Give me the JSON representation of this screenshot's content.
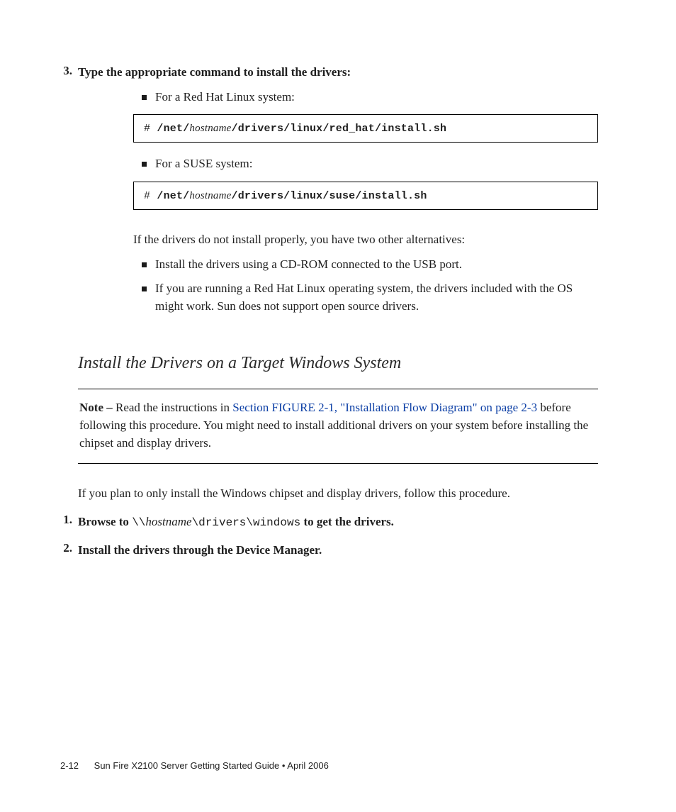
{
  "step3": {
    "num": "3.",
    "text": "Type the appropriate command to install the drivers:",
    "bullet_redhat": "For a Red Hat Linux system:",
    "bullet_suse": "For a SUSE system:"
  },
  "code_redhat": {
    "hash": "#",
    "seg1": "/net/",
    "seg2": "hostname",
    "seg3": "/drivers/linux/red_hat/install.sh"
  },
  "code_suse": {
    "hash": "#",
    "seg1": "/net/",
    "seg2": "hostname",
    "seg3": "/drivers/linux/suse/install.sh"
  },
  "alt_intro": "If the drivers do not install properly, you have two other alternatives:",
  "alt1": "Install the drivers using a CD-ROM connected to the USB port.",
  "alt2": "If you are running a Red Hat Linux operating system, the drivers included with the OS might work. Sun does not support open source drivers.",
  "section_title": "Install the Drivers on a Target Windows System",
  "note": {
    "label": "Note – ",
    "pre": "Read the instructions in ",
    "link": "Section FIGURE 2-1, \"Installation Flow Diagram\" on page 2-3",
    "post": " before following this procedure. You might need to install additional drivers on your system before installing the chipset and display drivers."
  },
  "plan_para": "If you plan to only install the Windows chipset and display drivers, follow this procedure.",
  "win_step1": {
    "num": "1.",
    "pre": "Browse to ",
    "path_a": "\\\\",
    "path_b": "hostname",
    "path_c": "\\drivers\\windows",
    "post": " to get the drivers."
  },
  "win_step2": {
    "num": "2.",
    "text": "Install the drivers through the Device Manager."
  },
  "footer": {
    "page": "2-12",
    "title": "Sun Fire X2100 Server Getting Started Guide  •  April 2006"
  }
}
